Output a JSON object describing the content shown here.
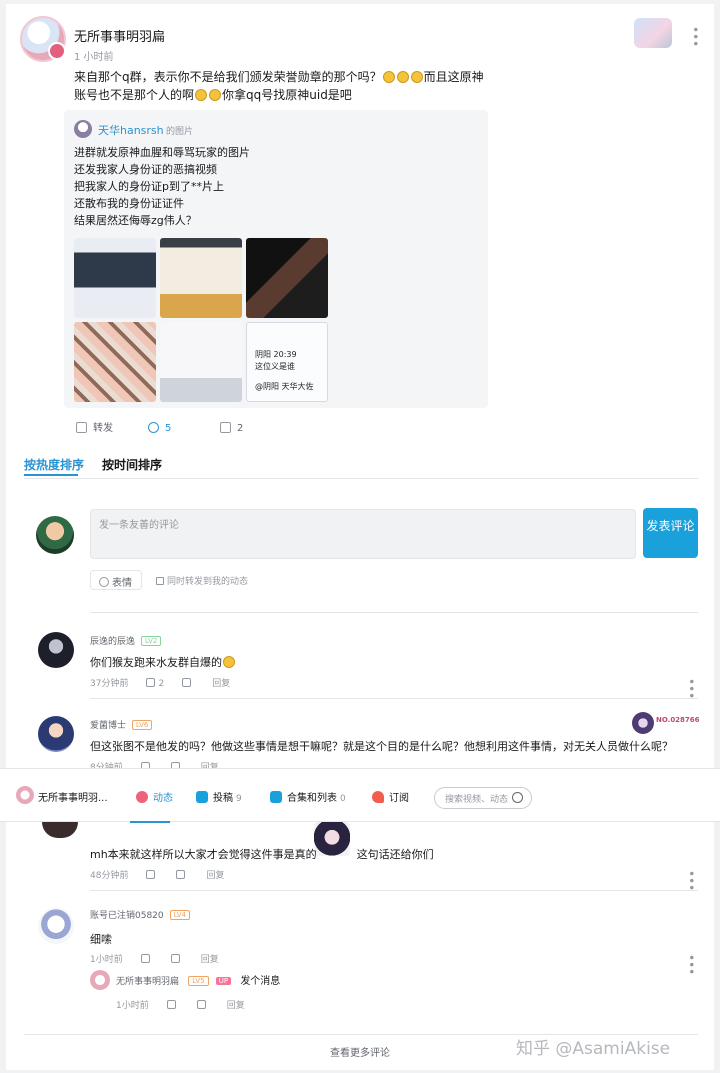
{
  "post": {
    "author": "无所事事明羽扁",
    "time": "1 小时前",
    "text_a": "来自那个q群，表示你不是给我们颁发荣誉勋章的那个吗？",
    "text_b": "而且这原神账号也不是那个人的啊",
    "text_c": "你拿qq号找原神uid是吧",
    "quote": {
      "user": "天华hansrsh",
      "suffix": "的图片",
      "lines": [
        "进群就发原神血腥和辱骂玩家的图片",
        "还发我家人身份证的恶搞视频",
        "把我家人的身份证p到了**片上",
        "还散布我的身份证证件",
        "结果居然还侮辱zg伟人？"
      ],
      "image_captions": [
        "阴阳 20:39",
        "这位义是谁",
        "@阴阳 天华大佐"
      ]
    },
    "actions": {
      "repost": "转发",
      "comments": "5",
      "likes": "2"
    }
  },
  "sort": {
    "hot": "按热度排序",
    "time": "按时间排序"
  },
  "composer": {
    "placeholder": "发一条友善的评论",
    "send": "发表评论",
    "emoji_btn": "表情",
    "repost_chk": "同时转发到我的动态"
  },
  "comments": [
    {
      "name": "辰逸的辰逸",
      "level": "LV2",
      "text": "你们猴友跑来水友群自爆的",
      "time": "37分钟前",
      "likes": "2",
      "reply": "回复"
    },
    {
      "name": "爱菌博士",
      "level": "LV6",
      "badge": "NO.028766",
      "text": "但这张图不是他发的吗？他做这些事情是想干嘛呢？就是这个目的是什么呢？他想利用这件事情，对无关人员做什么呢？",
      "time": "8分钟前",
      "reply": "回复"
    },
    {
      "text_a": "mh本来就这样所以大家才会觉得这件事是真的",
      "text_b": "这句话还给你们",
      "time": "48分钟前",
      "reply": "回复"
    },
    {
      "name": "账号已注销05820",
      "level": "LV4",
      "text": "细嗦",
      "time": "1小时前",
      "reply": "回复"
    }
  ],
  "sub_reply": {
    "name": "无所事事明羽扁",
    "level": "LV5",
    "up_tag": "UP",
    "text": "发个消息",
    "time": "1小时前",
    "reply": "回复"
  },
  "navbar": {
    "name": "无所事事明羽...",
    "dynamic": "动态",
    "submissions": "投稿",
    "submissions_count": "9",
    "collections": "合集和列表",
    "collections_count": "0",
    "subscribe": "订阅",
    "search_placeholder": "搜索视频、动态"
  },
  "footer": {
    "see_more": "查看更多评论",
    "watermark": "知乎 @AsamiAkise"
  },
  "colors": {
    "accent": "#1aa1dc",
    "link": "#2a93d3"
  }
}
